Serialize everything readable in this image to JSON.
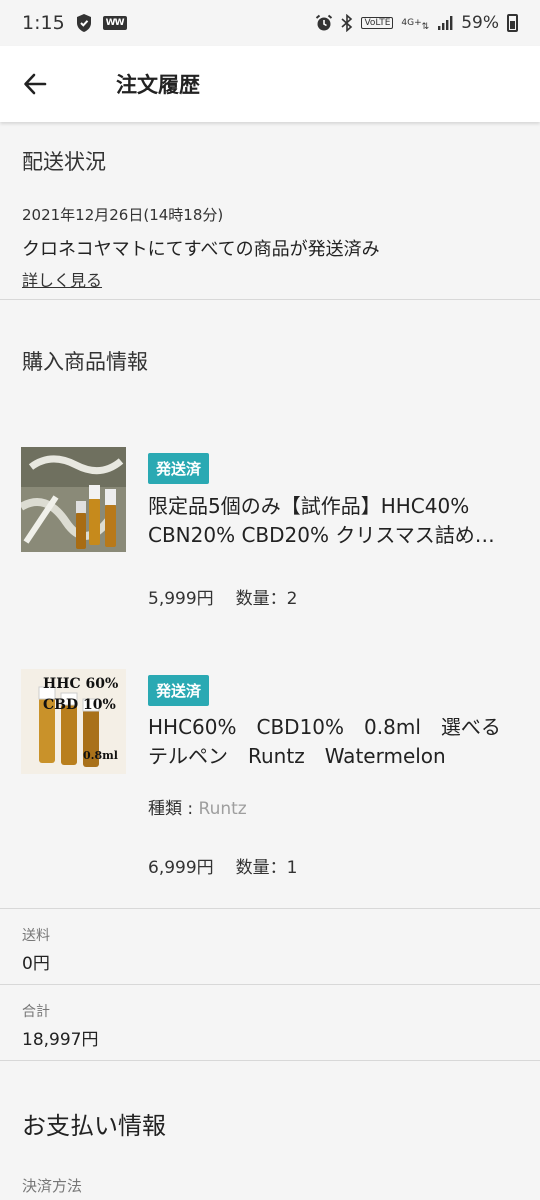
{
  "status_bar": {
    "time": "1:15",
    "volte": "VoLTE",
    "network": "4G+",
    "battery_percent": "59%",
    "icons": [
      "shield-icon",
      "ww-app-icon",
      "alarm-icon",
      "bluetooth-icon",
      "signal-icon",
      "battery-icon"
    ]
  },
  "app_bar": {
    "title": "注文履歴",
    "back_icon": "arrow-back-icon"
  },
  "shipping": {
    "title": "配送状況",
    "date": "2021年12月26日(14時18分)",
    "status_text": "クロネコヤマトにてすべての商品が発送済み",
    "details_link": "詳しく見る"
  },
  "purchased": {
    "title": "購入商品情報",
    "items": [
      {
        "badge": "発送済",
        "name": "限定品5個のみ【試作品】HHC40% CBN20% CBD20% クリスマス詰め…",
        "price": "5,999円",
        "quantity": "数量：2"
      },
      {
        "badge": "発送済",
        "name": "HHC60%　CBD10%　0.8ml　選べるテルペン　Runtz　Watermelon",
        "variant_label": "種類 : ",
        "variant_value": "Runtz",
        "price": "6,999円",
        "quantity": "数量：1",
        "image_text": [
          "HHC 60%",
          "CBD 10%",
          "0.8ml"
        ]
      }
    ]
  },
  "shipping_fee": {
    "label": "送料",
    "value": "0円"
  },
  "total": {
    "label": "合計",
    "value": "18,997円"
  },
  "payment": {
    "title": "お支払い情報",
    "method_label": "決済方法"
  }
}
